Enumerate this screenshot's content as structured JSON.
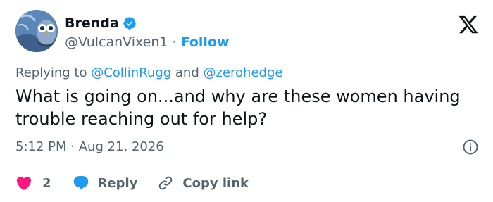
{
  "author": {
    "name": "Brenda",
    "handle": "@VulcanVixen1",
    "separator": "·",
    "follow_label": "Follow",
    "avatar_icon": "owl-avatar",
    "verified_icon": "verified-badge-icon"
  },
  "platform_icon": "x-logo-icon",
  "reply_context": {
    "prefix": "Replying to",
    "mention_1": "@CollinRugg",
    "connector": "and",
    "mention_2": "@zerohedge"
  },
  "tweet": {
    "text": "What is going on...and why are these women having trouble reaching out for help?",
    "time": "5:12 PM",
    "separator": "·",
    "date": "Aug 21, 2026"
  },
  "actions": {
    "like_count": "2",
    "reply_label": "Reply",
    "copy_link_label": "Copy link"
  },
  "colors": {
    "accent": "#1d9bf0",
    "like": "#f91880",
    "muted": "#536471",
    "text": "#0f1419",
    "divider": "#cfd9de"
  }
}
